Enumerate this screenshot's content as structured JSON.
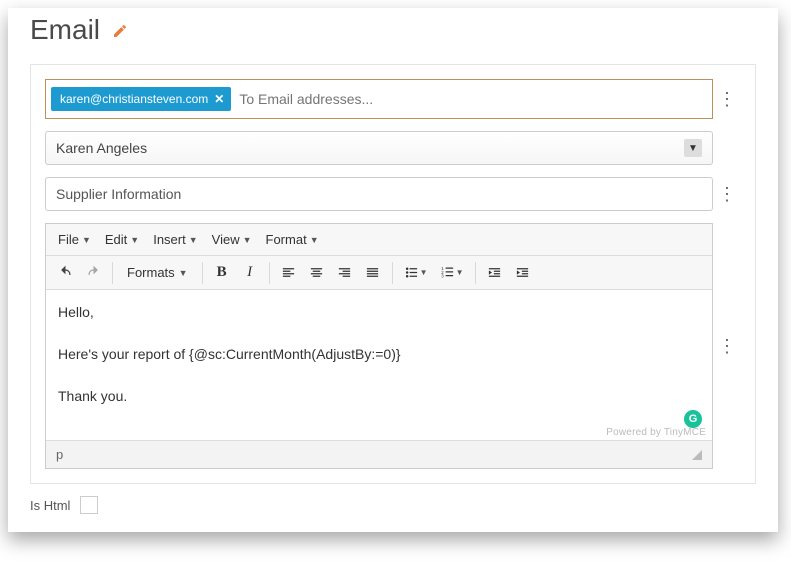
{
  "header": {
    "title": "Email"
  },
  "to": {
    "chip_email": "karen@christiansteven.com",
    "placeholder": "To Email addresses..."
  },
  "from_select": {
    "value": "Karen Angeles"
  },
  "subject": {
    "value": "Supplier Information"
  },
  "menus": {
    "file": "File",
    "edit": "Edit",
    "insert": "Insert",
    "view": "View",
    "format": "Format"
  },
  "toolbar": {
    "formats": "Formats"
  },
  "body": {
    "p1": "Hello,",
    "p2": "Here's your report of {@sc:CurrentMonth(AdjustBy:=0)}",
    "p3": "Thank you."
  },
  "powered_by": "Powered by TinyMCE",
  "statusbar_path": "p",
  "ishtml_label": "Is Html",
  "grammarly_letter": "G"
}
